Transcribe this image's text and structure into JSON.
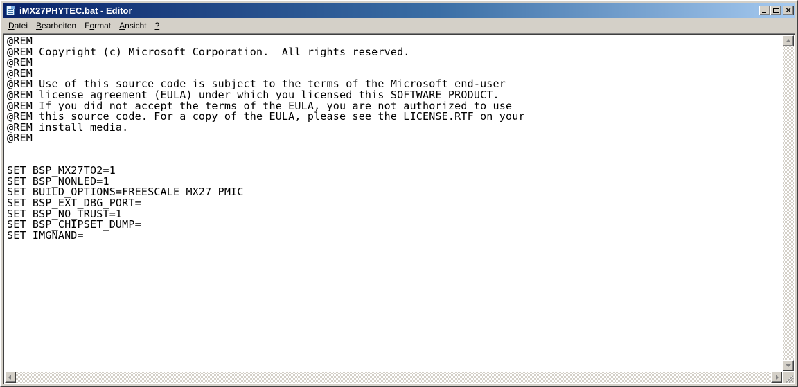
{
  "window": {
    "title": "iMX27PHYTEC.bat - Editor",
    "icon": "notepad-icon",
    "controls": {
      "minimize": "minimize-icon",
      "maximize": "maximize-icon",
      "close_glyph": "✕"
    }
  },
  "menu": [
    {
      "pre": "",
      "ul": "D",
      "post": "atei"
    },
    {
      "pre": "",
      "ul": "B",
      "post": "earbeiten"
    },
    {
      "pre": "F",
      "ul": "o",
      "post": "rmat"
    },
    {
      "pre": "",
      "ul": "A",
      "post": "nsicht"
    },
    {
      "pre": "",
      "ul": "?",
      "post": ""
    }
  ],
  "document": {
    "lines": [
      "@REM",
      "@REM Copyright (c) Microsoft Corporation.  All rights reserved.",
      "@REM",
      "@REM",
      "@REM Use of this source code is subject to the terms of the Microsoft end-user",
      "@REM license agreement (EULA) under which you licensed this SOFTWARE PRODUCT.",
      "@REM If you did not accept the terms of the EULA, you are not authorized to use",
      "@REM this source code. For a copy of the EULA, please see the LICENSE.RTF on your",
      "@REM install media.",
      "@REM",
      "",
      "",
      "SET BSP_MX27TO2=1",
      "SET BSP_NONLED=1",
      "SET BUILD_OPTIONS=FREESCALE MX27 PMIC",
      "SET BSP_EXT_DBG_PORT=",
      "SET BSP_NO_TRUST=1",
      "SET BSP_CHIPSET_DUMP=",
      "SET IMGNAND="
    ]
  },
  "colors": {
    "title_gradient_start": "#0a246a",
    "title_gradient_end": "#a6caf0",
    "face": "#d4d0c8"
  }
}
